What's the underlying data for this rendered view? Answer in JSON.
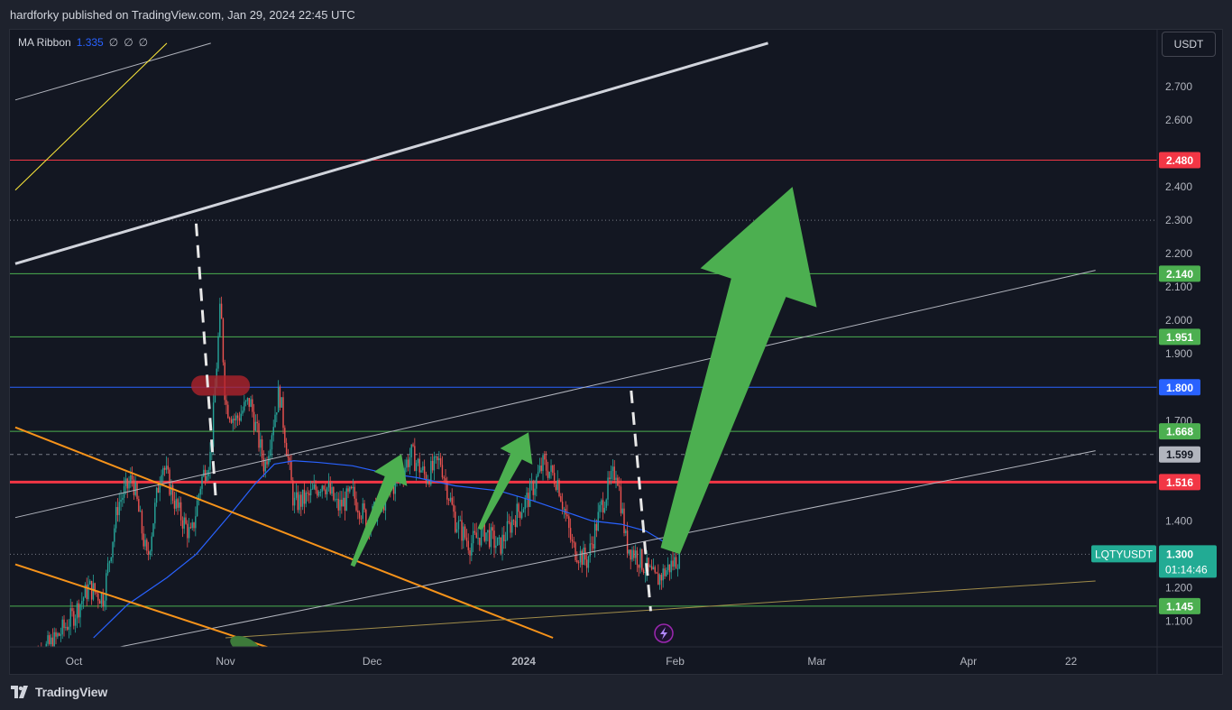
{
  "header": {
    "publisher": "hardforky published on TradingView.com, Jan 29, 2024 22:45 UTC"
  },
  "indicator": {
    "name": "MA Ribbon",
    "value": "1.335",
    "nulls": [
      "∅",
      "∅",
      "∅"
    ]
  },
  "currency": "USDT",
  "footer": {
    "logo_text": "TradingView"
  },
  "colors": {
    "background": "#131722",
    "up_candle": "#26a69a",
    "down_candle": "#ef5350",
    "ma_line": "#2962ff",
    "orange_trend": "#f7931a",
    "arrow_green": "#4caf50",
    "red_level": "#f23645",
    "green_level": "#4caf50",
    "blue_level": "#2962ff"
  },
  "chart_data": {
    "type": "candlestick",
    "symbol": "LQTYUSDT",
    "last_price": 1.3,
    "countdown": "01:14:46",
    "ylim": [
      1.05,
      2.83
    ],
    "x_ticks": [
      {
        "label": "Oct",
        "date": "2023-10-01"
      },
      {
        "label": "Nov",
        "date": "2023-11-01"
      },
      {
        "label": "Dec",
        "date": "2023-12-01"
      },
      {
        "label": "2024",
        "date": "2024-01-01",
        "bold": true
      },
      {
        "label": "Feb",
        "date": "2024-02-01"
      },
      {
        "label": "Mar",
        "date": "2024-03-01"
      },
      {
        "label": "Apr",
        "date": "2024-04-01"
      },
      {
        "label": "22",
        "date": "2024-04-22"
      }
    ],
    "y_ticks": [
      "1.100",
      "1.200",
      "1.400",
      "1.700",
      "1.900",
      "2.000",
      "2.100",
      "2.200",
      "2.300",
      "2.400",
      "2.600",
      "2.700"
    ],
    "levels": [
      {
        "price": 2.48,
        "label": "2.480",
        "color": "#f23645",
        "width": 1
      },
      {
        "price": 2.3,
        "label": "",
        "color": "#787b86",
        "width": 1,
        "dotted": true
      },
      {
        "price": 2.14,
        "label": "2.140",
        "color": "#4caf50",
        "width": 1
      },
      {
        "price": 1.951,
        "label": "1.951",
        "color": "#4caf50",
        "width": 1
      },
      {
        "price": 1.8,
        "label": "1.800",
        "color": "#2962ff",
        "width": 1
      },
      {
        "price": 1.668,
        "label": "1.668",
        "color": "#4caf50",
        "width": 1
      },
      {
        "price": 1.599,
        "label": "1.599",
        "color": "#787b86",
        "width": 1,
        "dashed": true
      },
      {
        "price": 1.516,
        "label": "1.516",
        "color": "#f23645",
        "width": 3
      },
      {
        "price": 1.3,
        "label": "",
        "color": "#787b86",
        "width": 1,
        "dotted": true
      },
      {
        "price": 1.145,
        "label": "1.145",
        "color": "#4caf50",
        "width": 1
      }
    ],
    "trendlines": [
      {
        "from": [
          "2023-09-19",
          2.17
        ],
        "to": [
          "2024-02-20",
          2.83
        ],
        "color": "#d1d4dc",
        "width": 3
      },
      {
        "from": [
          "2023-09-19",
          2.66
        ],
        "to": [
          "2023-10-29",
          2.83
        ],
        "color": "#b2b5be",
        "width": 1
      },
      {
        "from": [
          "2023-09-19",
          2.39
        ],
        "to": [
          "2023-10-20",
          2.83
        ],
        "color": "#ffeb3b",
        "width": 1
      },
      {
        "from": [
          "2023-09-19",
          1.41
        ],
        "to": [
          "2024-04-27",
          2.15
        ],
        "color": "#b2b5be",
        "width": 1
      },
      {
        "from": [
          "2023-09-19",
          0.96
        ],
        "to": [
          "2024-04-27",
          1.61
        ],
        "color": "#b2b5be",
        "width": 1
      },
      {
        "from": [
          "2023-09-19",
          1.68
        ],
        "to": [
          "2024-01-07",
          1.05
        ],
        "color": "#f7931a",
        "width": 2
      },
      {
        "from": [
          "2023-09-19",
          1.27
        ],
        "to": [
          "2023-11-10",
          1.02
        ],
        "color": "#f7931a",
        "width": 2
      },
      {
        "from": [
          "2023-11-01",
          1.05
        ],
        "to": [
          "2024-04-27",
          1.22
        ],
        "color": "#a08c4a",
        "width": 1
      }
    ],
    "dashed_verticals": [
      {
        "from": [
          "2023-10-26",
          2.29
        ],
        "to": [
          "2023-10-30",
          1.47
        ]
      },
      {
        "from": [
          "2024-01-23",
          1.79
        ],
        "to": [
          "2024-01-27",
          1.13
        ]
      }
    ],
    "red_highlight": {
      "from_date": "2023-10-25",
      "to_date": "2023-11-06",
      "price_high": 1.835,
      "price_low": 1.775
    },
    "small_arrows": [
      {
        "from": [
          "2023-11-27",
          1.265
        ],
        "to": [
          "2023-12-07",
          1.6
        ]
      },
      {
        "from": [
          "2023-12-23",
          1.375
        ],
        "to": [
          "2024-01-02",
          1.665
        ]
      }
    ],
    "big_arrow": {
      "from": [
        "2024-01-31",
        1.31
      ],
      "to": [
        "2024-02-25",
        2.4
      ]
    },
    "ma_ribbon": [
      [
        "2023-10-05",
        1.05
      ],
      [
        "2023-10-12",
        1.15
      ],
      [
        "2023-10-20",
        1.23
      ],
      [
        "2023-10-26",
        1.3
      ],
      [
        "2023-11-02",
        1.42
      ],
      [
        "2023-11-07",
        1.51
      ],
      [
        "2023-11-11",
        1.57
      ],
      [
        "2023-11-15",
        1.58
      ],
      [
        "2023-11-20",
        1.575
      ],
      [
        "2023-11-27",
        1.565
      ],
      [
        "2023-12-03",
        1.545
      ],
      [
        "2023-12-10",
        1.53
      ],
      [
        "2023-12-18",
        1.505
      ],
      [
        "2023-12-27",
        1.49
      ],
      [
        "2024-01-03",
        1.46
      ],
      [
        "2024-01-09",
        1.43
      ],
      [
        "2024-01-15",
        1.4
      ],
      [
        "2024-01-21",
        1.39
      ],
      [
        "2024-01-26",
        1.37
      ],
      [
        "2024-01-30",
        1.335
      ]
    ],
    "price_path": [
      [
        "2023-09-22",
        0.98
      ],
      [
        "2023-09-27",
        1.04
      ],
      [
        "2023-10-01",
        1.12
      ],
      [
        "2023-10-04",
        1.2
      ],
      [
        "2023-10-07",
        1.17
      ],
      [
        "2023-10-10",
        1.45
      ],
      [
        "2023-10-13",
        1.53
      ],
      [
        "2023-10-16",
        1.28
      ],
      [
        "2023-10-19",
        1.58
      ],
      [
        "2023-10-22",
        1.44
      ],
      [
        "2023-10-25",
        1.35
      ],
      [
        "2023-10-27",
        1.52
      ],
      [
        "2023-10-29",
        1.6
      ],
      [
        "2023-10-31",
        2.05
      ],
      [
        "2023-11-01",
        1.75
      ],
      [
        "2023-11-03",
        1.7
      ],
      [
        "2023-11-06",
        1.76
      ],
      [
        "2023-11-09",
        1.56
      ],
      [
        "2023-11-12",
        1.79
      ],
      [
        "2023-11-15",
        1.45
      ],
      [
        "2023-11-18",
        1.47
      ],
      [
        "2023-11-21",
        1.52
      ],
      [
        "2023-11-24",
        1.44
      ],
      [
        "2023-11-27",
        1.48
      ],
      [
        "2023-11-30",
        1.4
      ],
      [
        "2023-12-03",
        1.45
      ],
      [
        "2023-12-06",
        1.52
      ],
      [
        "2023-12-09",
        1.6
      ],
      [
        "2023-12-12",
        1.53
      ],
      [
        "2023-12-15",
        1.58
      ],
      [
        "2023-12-18",
        1.4
      ],
      [
        "2023-12-21",
        1.33
      ],
      [
        "2023-12-24",
        1.37
      ],
      [
        "2023-12-27",
        1.32
      ],
      [
        "2023-12-30",
        1.41
      ],
      [
        "2024-01-02",
        1.47
      ],
      [
        "2024-01-05",
        1.57
      ],
      [
        "2024-01-08",
        1.52
      ],
      [
        "2024-01-11",
        1.32
      ],
      [
        "2024-01-14",
        1.28
      ],
      [
        "2024-01-17",
        1.45
      ],
      [
        "2024-01-20",
        1.56
      ],
      [
        "2024-01-22",
        1.33
      ],
      [
        "2024-01-24",
        1.3
      ],
      [
        "2024-01-26",
        1.26
      ],
      [
        "2024-01-28",
        1.22
      ],
      [
        "2024-01-30",
        1.25
      ],
      [
        "2024-02-01",
        1.28
      ],
      [
        "2024-02-02",
        1.3
      ]
    ]
  }
}
